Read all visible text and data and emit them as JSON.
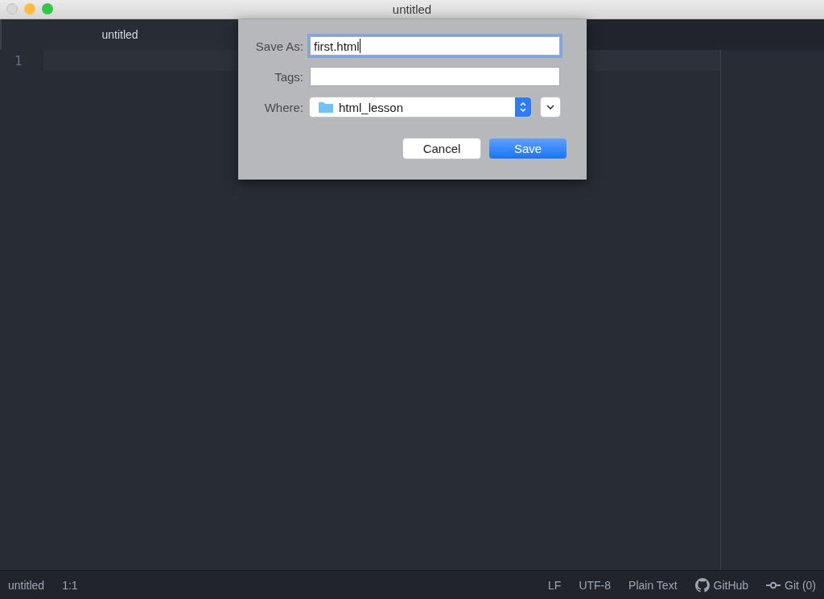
{
  "window": {
    "title": "untitled"
  },
  "tabs": [
    {
      "label": "untitled",
      "selected": true
    }
  ],
  "editor": {
    "line_numbers": [
      "1"
    ]
  },
  "save_dialog": {
    "save_as_label": "Save As:",
    "save_as_value": "first.html",
    "tags_label": "Tags:",
    "where_label": "Where:",
    "where_value": "html_lesson",
    "buttons": [
      {
        "label": "Cancel",
        "kind": "secondary"
      },
      {
        "label": "Save",
        "kind": "primary"
      }
    ]
  },
  "status_bar": {
    "left": [
      "untitled",
      "1:1"
    ],
    "right": [
      {
        "label": "LF",
        "kind": "text"
      },
      {
        "label": "UTF-8",
        "kind": "text"
      },
      {
        "label": "Plain Text",
        "kind": "text"
      },
      {
        "label": "GitHub",
        "kind": "github"
      },
      {
        "label": "Git (0)",
        "kind": "git"
      }
    ]
  }
}
